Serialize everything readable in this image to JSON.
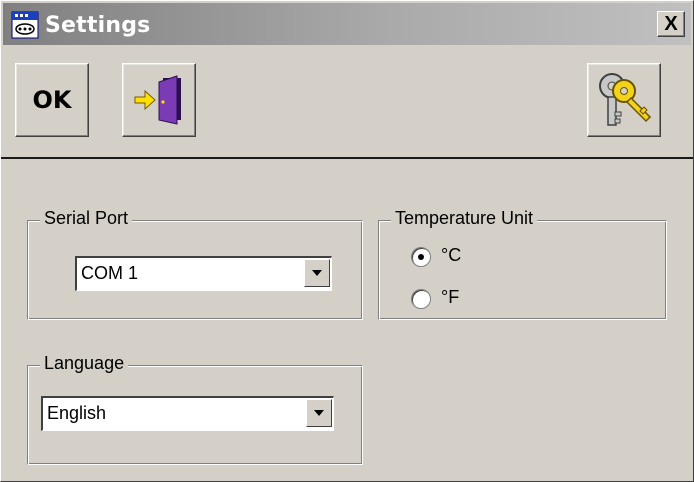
{
  "window": {
    "title": "Settings",
    "close_label": "X"
  },
  "toolbar": {
    "ok_label": "OK",
    "exit_icon": "exit-door-icon",
    "keys_icon": "keys-icon"
  },
  "serial_port": {
    "label": "Serial Port",
    "value": "COM 1"
  },
  "temperature_unit": {
    "label": "Temperature Unit",
    "options": [
      {
        "label": "°C",
        "selected": true
      },
      {
        "label": "°F",
        "selected": false
      }
    ]
  },
  "language": {
    "label": "Language",
    "value": "English"
  },
  "colors": {
    "face": "#d4d0c8",
    "title_gradient_start": "#808080",
    "door": "#6a2fa0",
    "arrow": "#ffe000",
    "key": "#f2d21a"
  }
}
